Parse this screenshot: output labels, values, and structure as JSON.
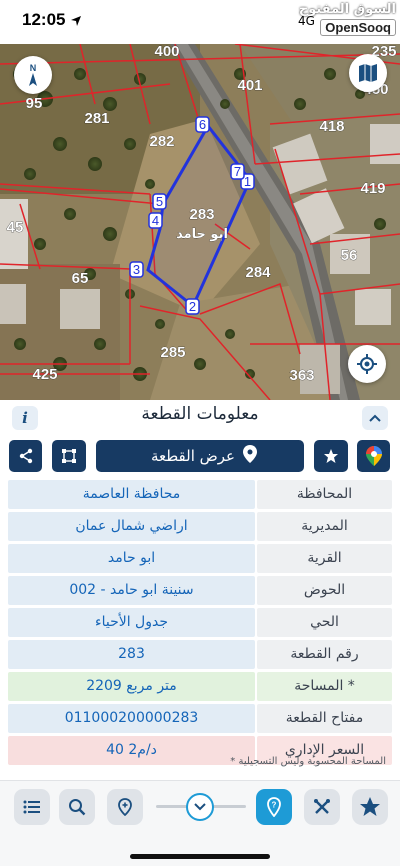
{
  "status_bar": {
    "time": "12:05",
    "signal": "4G",
    "watermark_ar": "السوق المفتوح",
    "watermark_en": "OpenSooq"
  },
  "map": {
    "compass_label": "N",
    "plot_numbers": [
      "400",
      "235",
      "401",
      "450",
      "95",
      "281",
      "282",
      "418",
      "419",
      "283",
      "45",
      "56",
      "65",
      "284",
      "285",
      "425",
      "363"
    ],
    "vertex_labels": [
      "1",
      "2",
      "3",
      "4",
      "5",
      "6",
      "7"
    ],
    "parcel_name": "ابو حامد"
  },
  "sheet": {
    "title": "معلومات القطعة",
    "info_label": "i",
    "view_plot_label": "عرض القطعة",
    "rows": [
      {
        "label": "المحافظة",
        "value": "محافظة العاصمة",
        "style": "normal"
      },
      {
        "label": "المديرية",
        "value": "اراضي شمال عمان",
        "style": "normal"
      },
      {
        "label": "القرية",
        "value": "ابو حامد",
        "style": "normal"
      },
      {
        "label": "الحوض",
        "value": "سنينة ابو حامد - 002",
        "style": "normal"
      },
      {
        "label": "الحي",
        "value": "جدول الأحياء",
        "style": "normal"
      },
      {
        "label": "رقم القطعة",
        "value": "283",
        "style": "normal"
      },
      {
        "label": "المساحة *",
        "value": "2209  متر مربع",
        "style": "green"
      },
      {
        "label": "مفتاح القطعة",
        "value": "011000200000283",
        "style": "normal"
      },
      {
        "label": "السعر الإداري",
        "value": "40 د/م2",
        "style": "pink"
      }
    ],
    "footnote": "* المساحة المحسوبة وليس التسجيلية"
  },
  "toolbar": {
    "icons": [
      "list-icon",
      "search-icon",
      "pin-icon",
      "chevron-down-icon",
      "help-pin-icon",
      "tools-icon",
      "star-icon"
    ]
  },
  "colors": {
    "accent": "#173a63",
    "value_text": "#1565b8",
    "parcel_outline": "#2233dd",
    "plot_lines": "#e0242a",
    "toolbar_active": "#1e9bd6"
  }
}
